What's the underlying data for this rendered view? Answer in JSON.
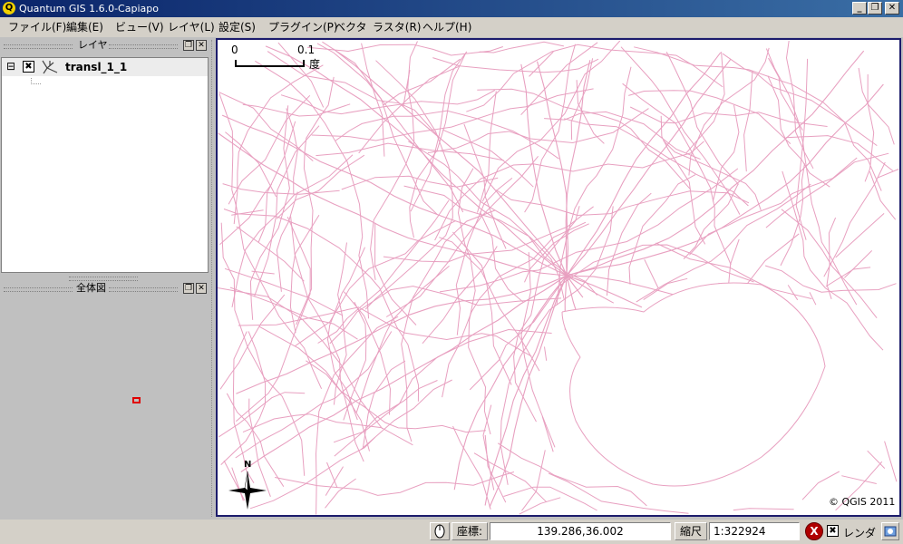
{
  "window": {
    "title": "Quantum GIS 1.6.0-Capiapo",
    "app_icon_letter": "Q",
    "minimize_glyph": "_",
    "restore_glyph": "❐",
    "close_glyph": "✕"
  },
  "menu": [
    "ファイル(F)",
    "編集(E)",
    "ビュー(V)",
    "レイヤ(L)",
    "設定(S)",
    "プラグイン(P)",
    "ベクタ",
    "ラスタ(R)",
    "ヘルプ(H)"
  ],
  "layers_dock": {
    "title": "レイヤ",
    "layer_name": "transl_1_1",
    "expander": "⊟",
    "checkbox": "✖"
  },
  "overview_dock": {
    "title": "全体図"
  },
  "map": {
    "scalebar": {
      "left": "0",
      "right": "0.1",
      "unit": "度"
    },
    "north_label": "N",
    "copyright": "© QGIS 2011",
    "line_color": "#e8a0c0"
  },
  "statusbar": {
    "coord_label": "座標:",
    "coord_value": "139.286,36.002",
    "scale_label": "縮尺",
    "scale_value": "1:322924",
    "render_label": "レンダ",
    "stop_glyph": "X"
  }
}
